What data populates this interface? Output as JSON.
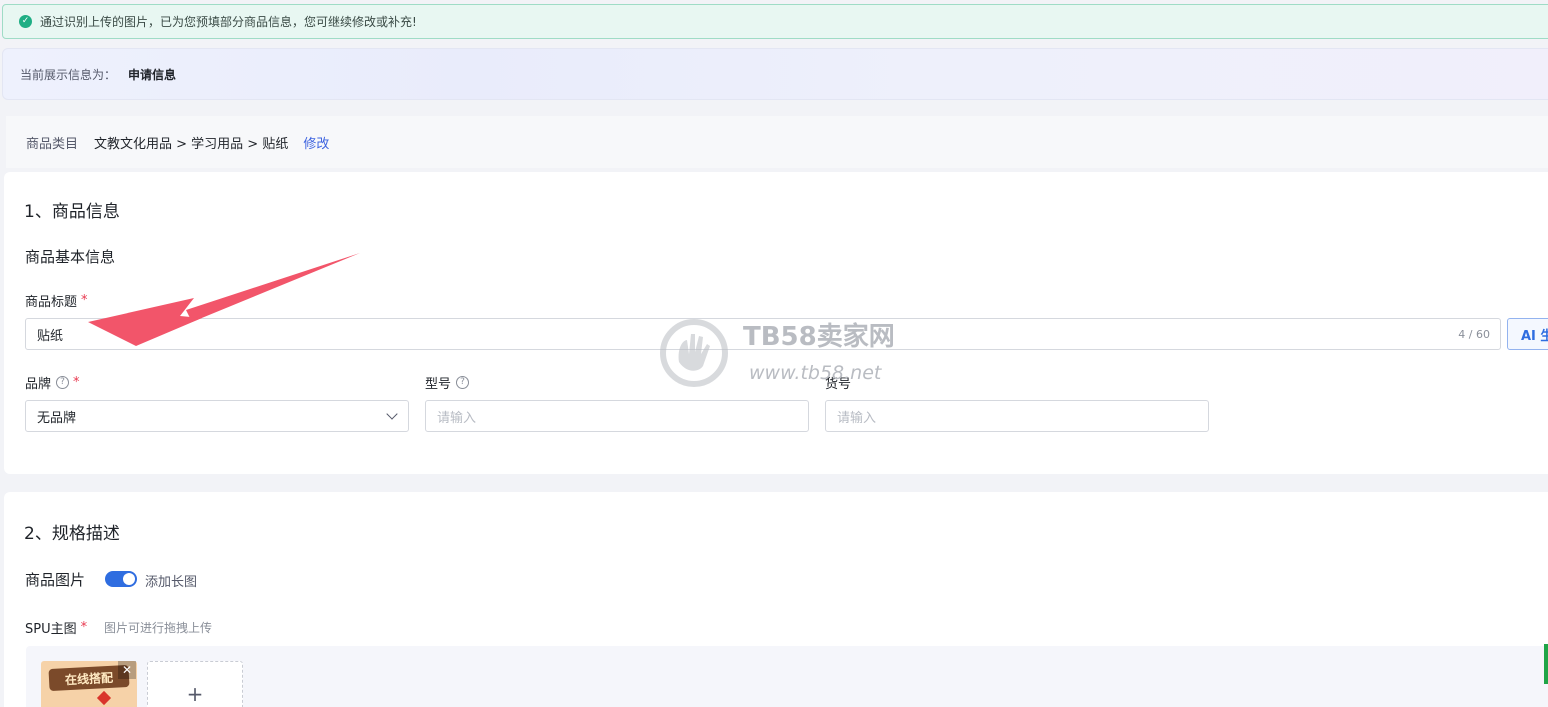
{
  "notice": {
    "text": "通过识别上传的图片，已为您预填部分商品信息，您可继续修改或补充!"
  },
  "mode_bar": {
    "label": "当前展示信息为：",
    "value": "申请信息"
  },
  "category": {
    "label": "商品类目",
    "path": "文教文化用品 > 学习用品 > 贴纸",
    "edit": "修改"
  },
  "section1": {
    "title": "1、商品信息",
    "subtitle": "商品基本信息",
    "title_field": {
      "label": "商品标题",
      "value": "贴纸",
      "counter": "4 / 60"
    },
    "ai_button": "AI 生成",
    "brand": {
      "label": "品牌",
      "value": "无品牌"
    },
    "model": {
      "label": "型号",
      "placeholder": "请输入"
    },
    "item_no": {
      "label": "货号",
      "placeholder": "请输入"
    }
  },
  "section2": {
    "title": "2、规格描述",
    "images_label": "商品图片",
    "toggle_label": "添加长图",
    "spu_label": "SPU主图",
    "spu_hint": "图片可进行拖拽上传",
    "thumb_text": "在线搭配",
    "add_symbol": "+"
  },
  "watermark": {
    "brand": "TB58卖家网",
    "url": "www.tb58.net"
  },
  "colors": {
    "accent": "#2f6de0",
    "required": "#e8384f",
    "success": "#1fae84",
    "annotation_arrow": "#f2556a"
  }
}
